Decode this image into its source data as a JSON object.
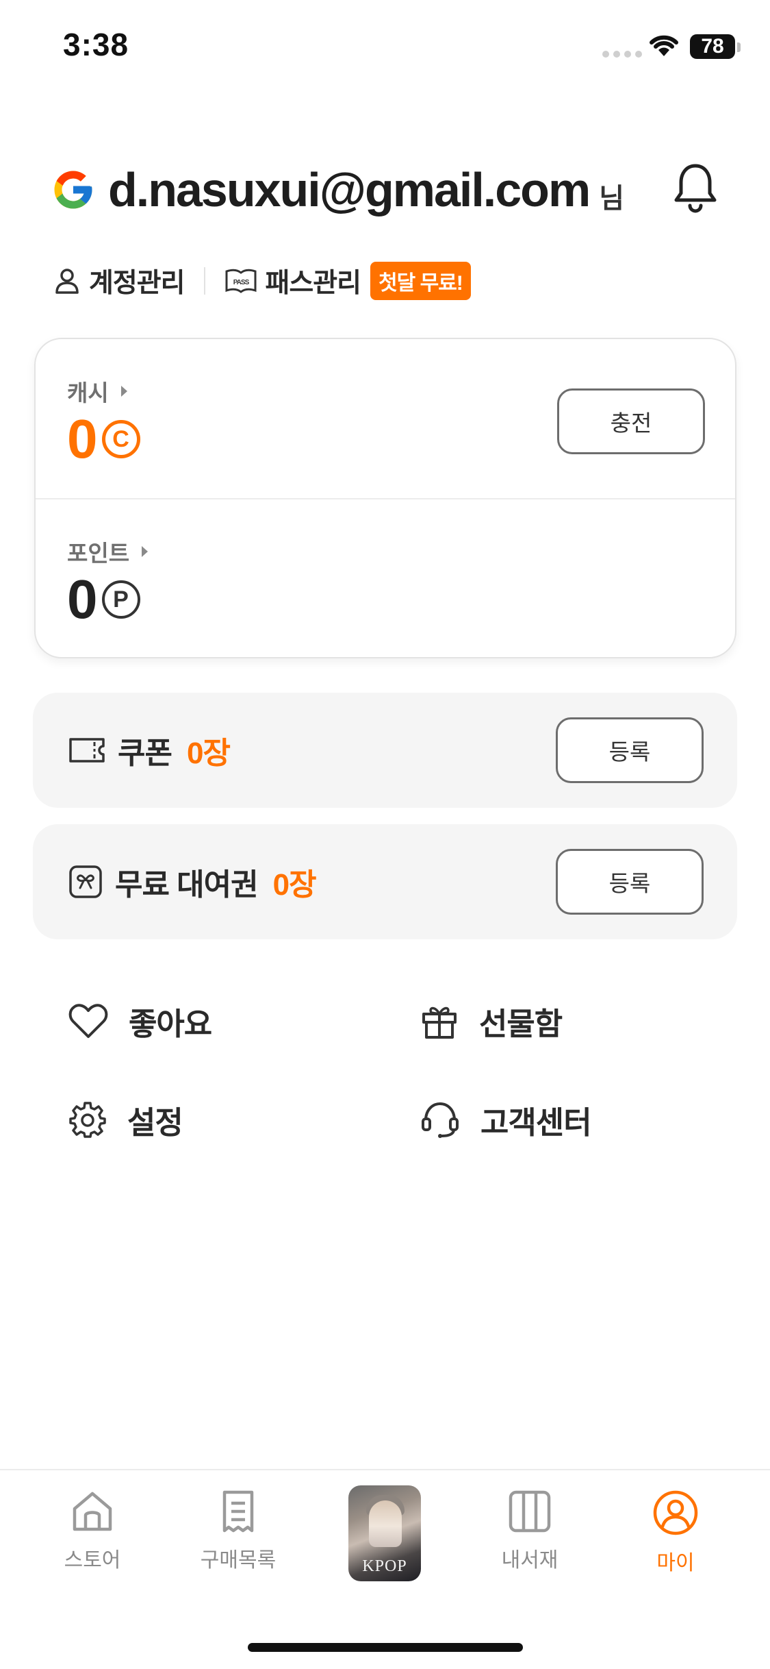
{
  "status_bar": {
    "time": "3:38",
    "battery": "78"
  },
  "header": {
    "email": "d.nasuxui@gmail.com",
    "suffix": "님"
  },
  "account_links": {
    "account_manage": "계정관리",
    "pass_manage": "패스관리",
    "pass_badge": "첫달 무료!"
  },
  "wallet": {
    "cash_label": "캐시",
    "cash_value": "0",
    "cash_unit_icon": "C",
    "charge_button": "충전",
    "point_label": "포인트",
    "point_value": "0",
    "point_unit_icon": "P"
  },
  "coupon": {
    "title": "쿠폰",
    "count": "0장",
    "button": "등록"
  },
  "rental": {
    "title": "무료 대여권",
    "count": "0장",
    "button": "등록"
  },
  "menu": {
    "like": "좋아요",
    "gift_box": "선물함",
    "settings": "설정",
    "support": "고객센터"
  },
  "tabbar": {
    "store": "스토어",
    "purchase_list": "구매목록",
    "featured_text": "KPOP",
    "library": "내서재",
    "my": "마이"
  },
  "colors": {
    "accent": "#ff7200",
    "text": "#2a2a2a",
    "muted": "#8a8a8a"
  }
}
